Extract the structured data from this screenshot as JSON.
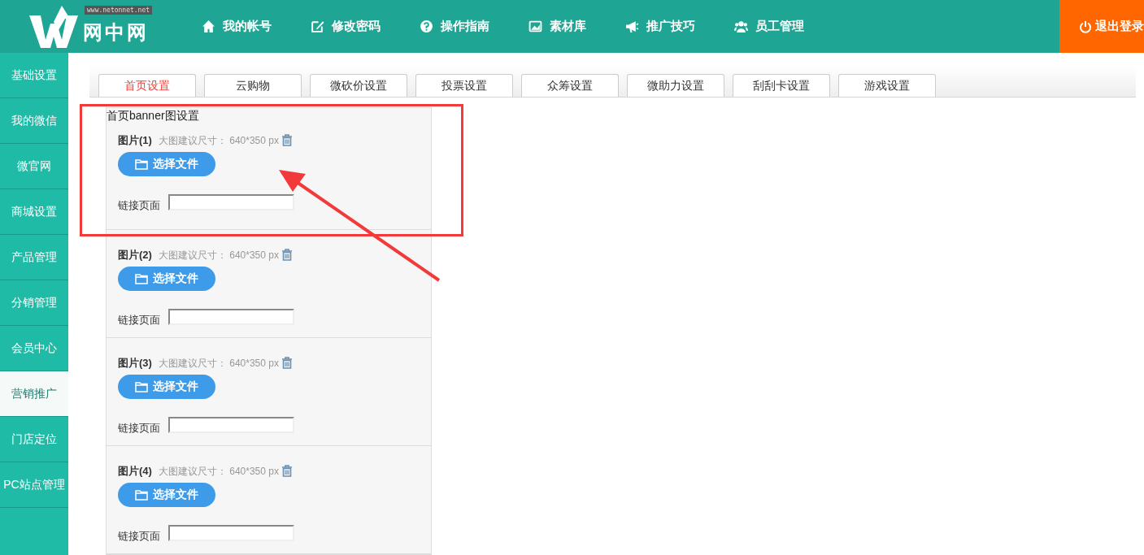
{
  "header": {
    "logo_text": "网中网",
    "logo_url": "www.netonnet.net",
    "nav": [
      {
        "label": "我的帐号",
        "kind": "home"
      },
      {
        "label": "修改密码",
        "kind": "edit"
      },
      {
        "label": "操作指南",
        "kind": "help"
      },
      {
        "label": "素材库",
        "kind": "picture"
      },
      {
        "label": "推广技巧",
        "kind": "megaphone"
      },
      {
        "label": "员工管理",
        "kind": "users"
      }
    ],
    "logout": "退出登录"
  },
  "sidebar": {
    "items": [
      {
        "label": "基础设置",
        "selected": false
      },
      {
        "label": "我的微信",
        "selected": false
      },
      {
        "label": "微官网",
        "selected": false
      },
      {
        "label": "商城设置",
        "selected": false
      },
      {
        "label": "产品管理",
        "selected": false
      },
      {
        "label": "分销管理",
        "selected": false
      },
      {
        "label": "会员中心",
        "selected": false
      },
      {
        "label": "营销推广",
        "selected": true
      },
      {
        "label": "门店定位",
        "selected": false
      },
      {
        "label": "PC站点管理",
        "selected": false
      }
    ]
  },
  "tabs": [
    {
      "label": "首页设置",
      "selected": true
    },
    {
      "label": "云购物",
      "selected": false
    },
    {
      "label": "微砍价设置",
      "selected": false
    },
    {
      "label": "投票设置",
      "selected": false
    },
    {
      "label": "众筹设置",
      "selected": false
    },
    {
      "label": "微助力设置",
      "selected": false
    },
    {
      "label": "刮刮卡设置",
      "selected": false
    },
    {
      "label": "游戏设置",
      "selected": false
    }
  ],
  "banner_section": {
    "title": "首页banner图设置",
    "images": [
      {
        "label": "图片(1)",
        "hint": "大图建议尺寸：",
        "size": "640*350 px",
        "button": "选择文件",
        "link_label": "链接页面"
      },
      {
        "label": "图片(2)",
        "hint": "大图建议尺寸：",
        "size": "640*350 px",
        "button": "选择文件",
        "link_label": "链接页面"
      },
      {
        "label": "图片(3)",
        "hint": "大图建议尺寸：",
        "size": "640*350 px",
        "button": "选择文件",
        "link_label": "链接页面"
      },
      {
        "label": "图片(4)",
        "hint": "大图建议尺寸：",
        "size": "640*350 px",
        "button": "选择文件",
        "link_label": "链接页面"
      }
    ]
  }
}
